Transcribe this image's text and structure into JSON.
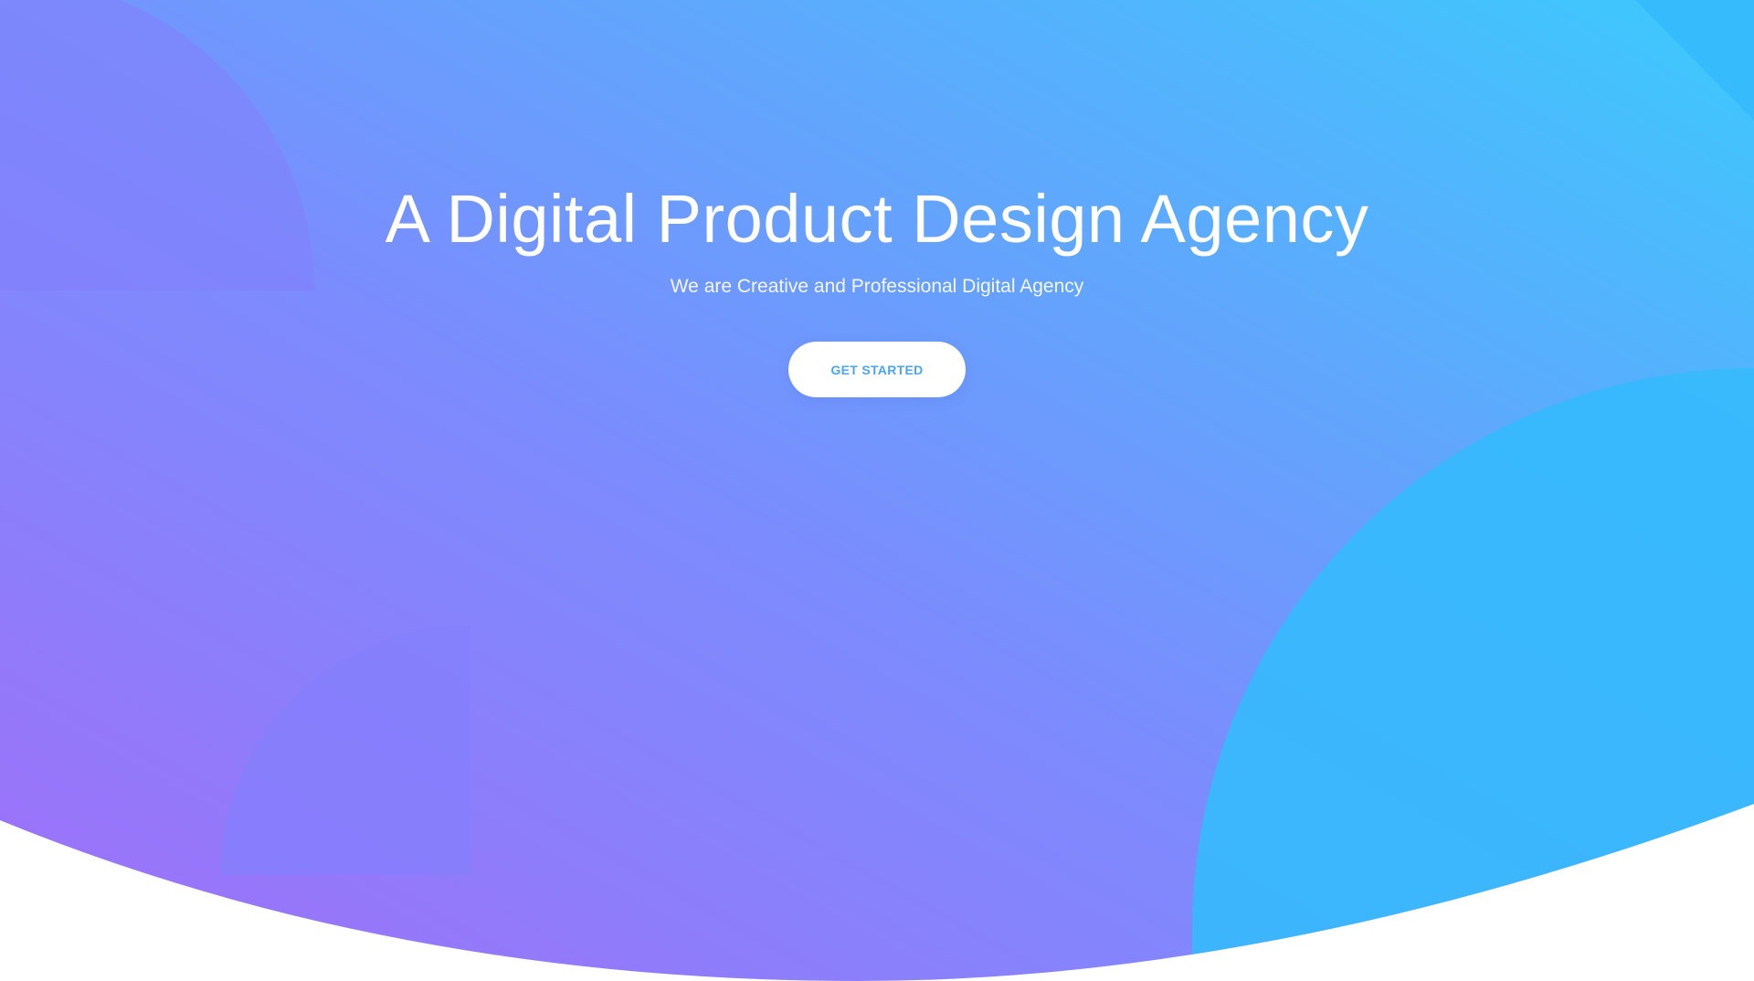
{
  "hero": {
    "title": "A Digital Product Design Agency",
    "subtitle": "We are Creative and Professional Digital Agency",
    "cta_label": "GET STARTED"
  },
  "colors": {
    "gradient_start": "#a06ff9",
    "gradient_mid": "#7b8cfd",
    "gradient_end": "#3ccafd",
    "shape_purple": "#847ffc",
    "shape_blue": "#35bafd",
    "button_text": "#4aa6e8",
    "page_background": "#ffffff"
  }
}
